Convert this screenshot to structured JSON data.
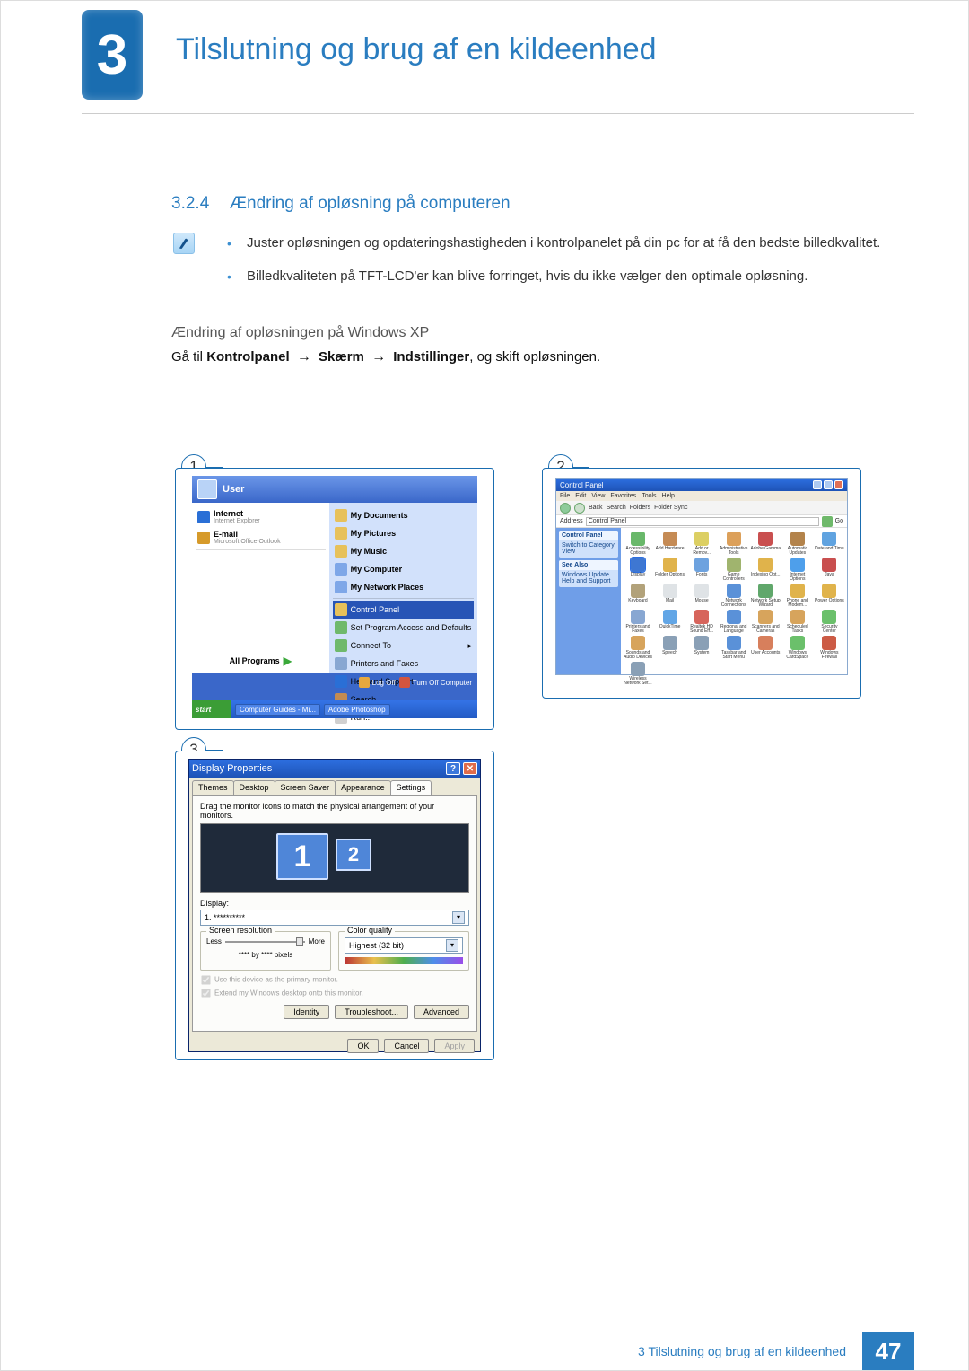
{
  "chapter": {
    "number": "3",
    "title": "Tilslutning og brug af en kildeenhed"
  },
  "section": {
    "number": "3.2.4",
    "title": "Ændring af opløsning på computeren"
  },
  "bullets": [
    "Juster opløsningen og opdateringshastigheden i kontrolpanelet på din pc for at få den bedste billedkvalitet.",
    "Billedkvaliteten på TFT-LCD'er kan blive forringet, hvis du ikke vælger den optimale opløsning."
  ],
  "subheading": "Ændring af opløsningen på Windows XP",
  "instruction": {
    "pre": "Gå til ",
    "b1": "Kontrolpanel",
    "b2": "Skærm",
    "b3": "Indstillinger",
    "post": ", og skift opløsningen."
  },
  "fig_badges": {
    "f1": "1",
    "f2": "2",
    "f3": "3"
  },
  "fig1": {
    "user": "User",
    "left": [
      {
        "label": "Internet",
        "sub": "Internet Explorer",
        "color": "#2a6fd6"
      },
      {
        "label": "E-mail",
        "sub": "Microsoft Office Outlook",
        "color": "#d69a2a"
      }
    ],
    "all_programs": "All Programs",
    "right_top": [
      {
        "label": "My Documents",
        "color": "#e7c15a"
      },
      {
        "label": "My Pictures",
        "color": "#e7c15a"
      },
      {
        "label": "My Music",
        "color": "#e7c15a"
      },
      {
        "label": "My Computer",
        "color": "#7ea7e8"
      },
      {
        "label": "My Network Places",
        "color": "#7ea7e8"
      }
    ],
    "right_bottom": [
      {
        "label": "Control Panel",
        "hi": true,
        "color": "#e7c15a"
      },
      {
        "label": "Set Program Access and Defaults",
        "color": "#6fb96b"
      },
      {
        "label": "Connect To",
        "color": "#6fb96b",
        "arrow": true
      },
      {
        "label": "Printers and Faxes",
        "color": "#88a7d2"
      },
      {
        "label": "Help and Support",
        "color": "#2a6fd6"
      },
      {
        "label": "Search",
        "color": "#c38b52"
      },
      {
        "label": "Run...",
        "color": "#d0d0d0"
      }
    ],
    "logoff": "Log Off",
    "turnoff": "Turn Off Computer",
    "start": "start",
    "tasks": [
      "Computer Guides - Mi...",
      "Adobe Photoshop"
    ]
  },
  "fig2": {
    "title": "Control Panel",
    "menu": [
      "File",
      "Edit",
      "View",
      "Favorites",
      "Tools",
      "Help"
    ],
    "toolbar": [
      "Back",
      "Search",
      "Folders",
      "Folder Sync"
    ],
    "address_label": "Address",
    "address_value": "Control Panel",
    "go_label": "Go",
    "side_header1": "Control Panel",
    "side_link1": "Switch to Category View",
    "side_header2": "See Also",
    "side_links2": [
      "Windows Update",
      "Help and Support"
    ],
    "items": [
      "Accessibility Options",
      "Add Hardware",
      "Add or Remov...",
      "Administrative Tools",
      "Adobe Gamma",
      "Automatic Updates",
      "Date and Time",
      "Display",
      "Folder Options",
      "Fonts",
      "Game Controllers",
      "Indexing Opt...",
      "Internet Options",
      "Java",
      "Keyboard",
      "Mail",
      "Mouse",
      "Network Connections",
      "Network Setup Wizard",
      "Phone and Modem...",
      "Power Options",
      "Printers and Faxes",
      "QuickTime",
      "Realtek HD Sound Eff...",
      "Regional and Language",
      "Scanners and Cameras",
      "Scheduled Tasks",
      "Security Center",
      "Sounds and Audio Devices",
      "Speech",
      "System",
      "Taskbar and Start Menu",
      "User Accounts",
      "Windows CardSpace",
      "Windows Firewall",
      "Wireless Network Set..."
    ],
    "item_colors": [
      "#69b86a",
      "#c58b55",
      "#dccf63",
      "#dca05a",
      "#c94f4f",
      "#b3834b",
      "#60a3e0",
      "#3e77d2",
      "#e0b34b",
      "#6da2df",
      "#a0b46e",
      "#e0b34b",
      "#4e9feb",
      "#c94f4f",
      "#b2a27a",
      "#dfe3e6",
      "#dfe3e6",
      "#5a91d8",
      "#60a76b",
      "#e0b34b",
      "#e0b34b",
      "#88a7d2",
      "#62a6e6",
      "#d7655c",
      "#5a91d8",
      "#d7a45c",
      "#d7a45c",
      "#6bc06b",
      "#d7a45c",
      "#8aa0b6",
      "#8aa0b6",
      "#5a91d8",
      "#d77f5c",
      "#6bc06b",
      "#cc5b45",
      "#8aa0b6"
    ]
  },
  "fig3": {
    "title": "Display Properties",
    "tabs": [
      "Themes",
      "Desktop",
      "Screen Saver",
      "Appearance",
      "Settings"
    ],
    "active_tab": 4,
    "desc": "Drag the monitor icons to match the physical arrangement of your monitors.",
    "mon1": "1",
    "mon2": "2",
    "display_label": "Display:",
    "display_value": "1. **********",
    "res_group": "Screen resolution",
    "res_less": "Less",
    "res_more": "More",
    "res_value": "**** by **** pixels",
    "cq_group": "Color quality",
    "cq_value": "Highest (32 bit)",
    "chk1": "Use this device as the primary monitor.",
    "chk2": "Extend my Windows desktop onto this monitor.",
    "btn_identity": "Identity",
    "btn_trouble": "Troubleshoot...",
    "btn_adv": "Advanced",
    "btn_ok": "OK",
    "btn_cancel": "Cancel",
    "btn_apply": "Apply"
  },
  "footer": {
    "text": "3 Tilslutning og brug af en kildeenhed",
    "page": "47"
  }
}
